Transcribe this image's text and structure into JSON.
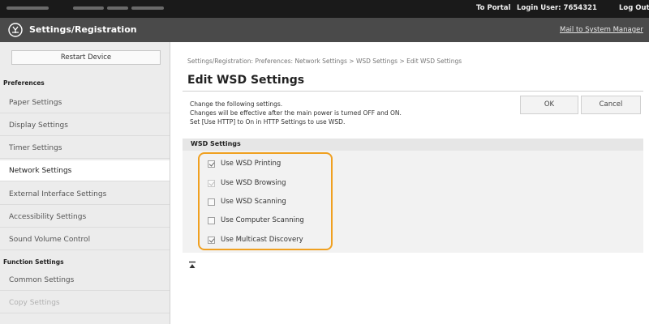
{
  "topbar": {
    "portal_link": "To Portal",
    "login_user": "Login User: 7654321",
    "logout_link": "Log Out"
  },
  "header": {
    "title": "Settings/Registration",
    "mail_link": "Mail to System Manager"
  },
  "sidebar": {
    "restart_button": "Restart Device",
    "preferences_heading": "Preferences",
    "preferences_items": [
      {
        "label": "Paper Settings"
      },
      {
        "label": "Display Settings"
      },
      {
        "label": "Timer Settings"
      },
      {
        "label": "Network Settings"
      },
      {
        "label": "External Interface Settings"
      },
      {
        "label": "Accessibility Settings"
      },
      {
        "label": "Sound Volume Control"
      }
    ],
    "function_heading": "Function Settings",
    "function_items": [
      {
        "label": "Common Settings"
      },
      {
        "label": "Copy Settings"
      }
    ]
  },
  "main": {
    "breadcrumb": "Settings/Registration: Preferences: Network Settings > WSD Settings > Edit WSD Settings",
    "title": "Edit WSD Settings",
    "description": [
      "Change the following settings.",
      "Changes will be effective after the main power is turned OFF and ON.",
      "Set [Use HTTP] to On in HTTP Settings to use WSD."
    ],
    "ok_button": "OK",
    "cancel_button": "Cancel",
    "section_heading": "WSD Settings",
    "options": [
      {
        "label": "Use WSD Printing",
        "checked": true,
        "disabled": false
      },
      {
        "label": "Use WSD Browsing",
        "checked": true,
        "disabled": true
      },
      {
        "label": "Use WSD Scanning",
        "checked": false,
        "disabled": false
      },
      {
        "label": "Use Computer Scanning",
        "checked": false,
        "disabled": false
      },
      {
        "label": "Use Multicast Discovery",
        "checked": true,
        "disabled": false
      }
    ]
  },
  "colors": {
    "highlight": "#f0a020",
    "topbar": "#1a1a1a",
    "header": "#4a4a4a"
  }
}
